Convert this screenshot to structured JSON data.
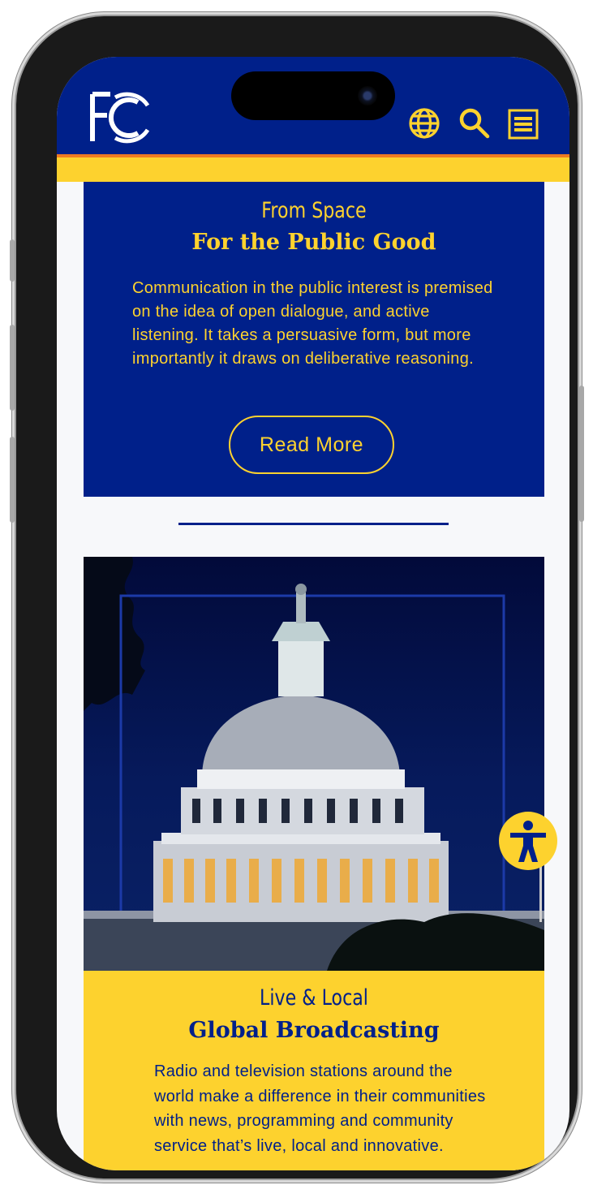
{
  "header": {
    "logo_alt": "FCC",
    "icons": [
      "globe-icon",
      "search-icon",
      "menu-icon"
    ]
  },
  "card_space": {
    "eyebrow": "From Space",
    "title": "For the Public Good",
    "body": "Communication in the public interest is premised on the idea of open dialogue, and active listening. It takes a persuasive form, but more importantly it draws on deliberative reasoning.",
    "button_label": "Read More"
  },
  "card_broadcast": {
    "image_subject": "capitol-dome-photo",
    "eyebrow": "Live & Local",
    "title": "Global Broadcasting",
    "body": "Radio and television stations around the world make a difference in their communities with news, programming and community service that’s live, local and innovative."
  },
  "colors": {
    "brand_blue": "#00208a",
    "brand_yellow": "#fdd22e",
    "accent_orange": "#ee7a22",
    "page_bg": "#f7f8fa"
  },
  "accessibility": {
    "icon": "accessibility-icon"
  }
}
